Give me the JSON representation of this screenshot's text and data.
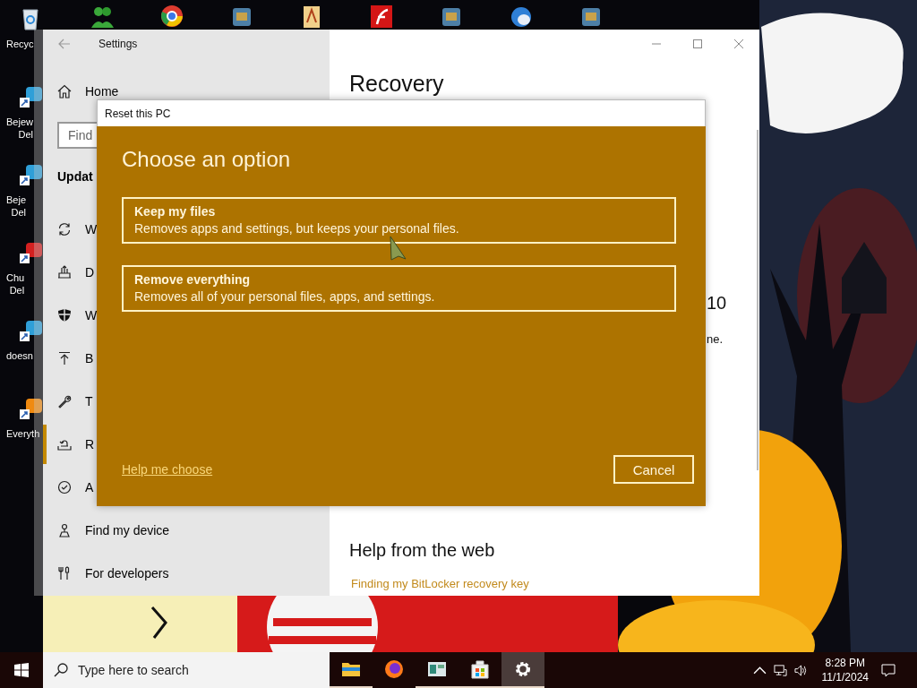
{
  "desktop_icons": [
    {
      "label_lines": [
        "Recyc"
      ]
    },
    {
      "label_lines": [
        "Bejew",
        "Del"
      ]
    },
    {
      "label_lines": [
        "Beje",
        "Del"
      ]
    },
    {
      "label_lines": [
        "Chu",
        "Del"
      ]
    },
    {
      "label_lines": [
        "doesn"
      ]
    },
    {
      "label_lines": [
        "Everyth"
      ]
    }
  ],
  "settings_window": {
    "title": "Settings",
    "home": "Home",
    "search_placeholder": "Find",
    "section": "Updat",
    "items": [
      {
        "kind": "update",
        "label": "W",
        "selected": false
      },
      {
        "kind": "delivery",
        "label": "D",
        "selected": false
      },
      {
        "kind": "shield",
        "label": "W",
        "selected": false
      },
      {
        "kind": "backup",
        "label": "B",
        "selected": false
      },
      {
        "kind": "troubleshoot",
        "label": "T",
        "selected": false
      },
      {
        "kind": "recovery",
        "label": "R",
        "selected": true
      },
      {
        "kind": "activation",
        "label": "A",
        "selected": false
      },
      {
        "kind": "find",
        "label": "Find my device",
        "selected": false
      },
      {
        "kind": "developers",
        "label": "For developers",
        "selected": false
      }
    ],
    "heading": "Recovery",
    "fragment_1": "10",
    "fragment_2": "ne.",
    "help_heading": "Help from the web",
    "help_link": "Finding my BitLocker recovery key"
  },
  "dialog": {
    "title": "Reset this PC",
    "heading": "Choose an option",
    "options": [
      {
        "title": "Keep my files",
        "description": "Removes apps and settings, but keeps your personal files."
      },
      {
        "title": "Remove everything",
        "description": "Removes all of your personal files, apps, and settings."
      }
    ],
    "help_link": "Help me choose",
    "cancel": "Cancel"
  },
  "taskbar": {
    "search_placeholder": "Type here to search",
    "apps": [
      {
        "kind": "folder",
        "selected": false,
        "running": true
      },
      {
        "kind": "browser",
        "selected": false,
        "running": false
      },
      {
        "kind": "window",
        "selected": false,
        "running": true
      },
      {
        "kind": "store",
        "selected": false,
        "running": true
      },
      {
        "kind": "gear",
        "selected": true,
        "running": true
      }
    ],
    "time": "8:28 PM",
    "date": "11/1/2024"
  }
}
